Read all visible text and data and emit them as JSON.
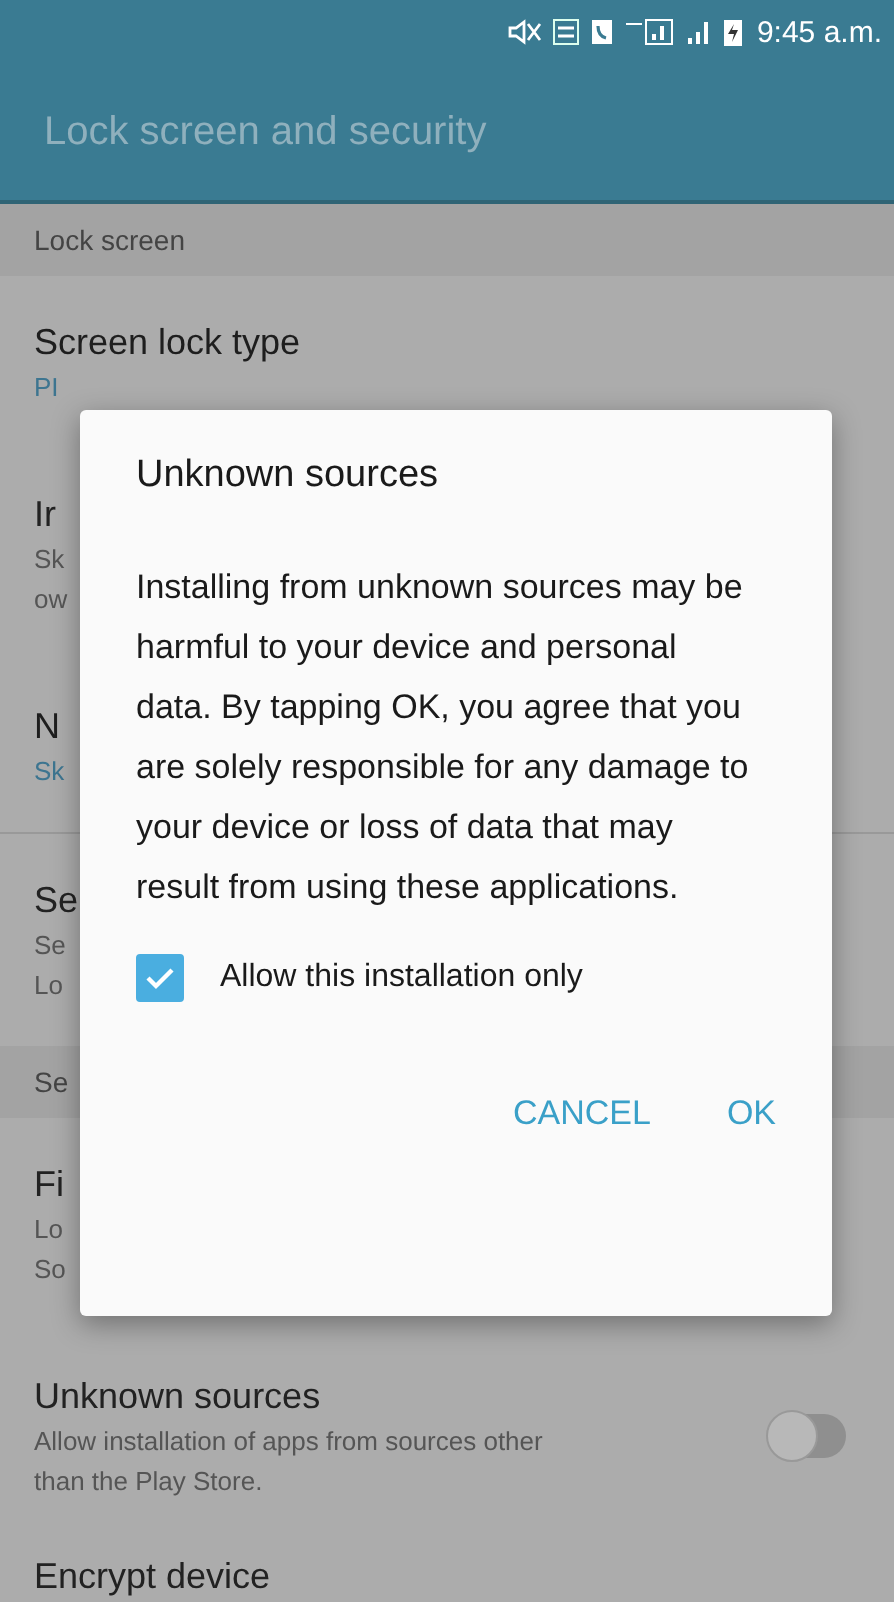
{
  "status_bar": {
    "time": "9:45 a.m."
  },
  "app_bar": {
    "title": "Lock screen and security"
  },
  "sections": [
    {
      "header": "Lock screen",
      "items": [
        {
          "kind": "value",
          "title": "Screen lock type",
          "summary": [
            "PI"
          ],
          "divider": false
        },
        {
          "kind": "description",
          "title": "Ir",
          "summary": [
            "Sk",
            "ow"
          ],
          "divider": false
        },
        {
          "kind": "value",
          "title": "N",
          "summary": [
            "Sk"
          ],
          "divider": true
        },
        {
          "kind": "description",
          "title": "Se",
          "summary": [
            "Se",
            "Lo"
          ],
          "divider": false
        }
      ]
    },
    {
      "header": "Se",
      "items": [
        {
          "kind": "description",
          "title": "Fi",
          "summary": [
            "Lo",
            "So"
          ],
          "divider": false
        },
        {
          "kind": "description",
          "title": "Unknown sources",
          "summary": [
            "Allow installation of apps from sources other",
            "than the Play Store."
          ],
          "divider": false,
          "toggle": {
            "on": false
          }
        },
        {
          "kind": "description",
          "title": "Encrypt device",
          "divider": false
        }
      ]
    }
  ],
  "dialog": {
    "title": "Unknown sources",
    "message": "Installing from unknown sources may be harmful to your device and personal data. By tapping OK, you agree that you are solely responsible for any damage to your device or loss of data that may result from using these applications.",
    "checkbox": {
      "label": "Allow this installation only",
      "checked": true
    },
    "buttons": [
      "CANCEL",
      "OK"
    ]
  }
}
